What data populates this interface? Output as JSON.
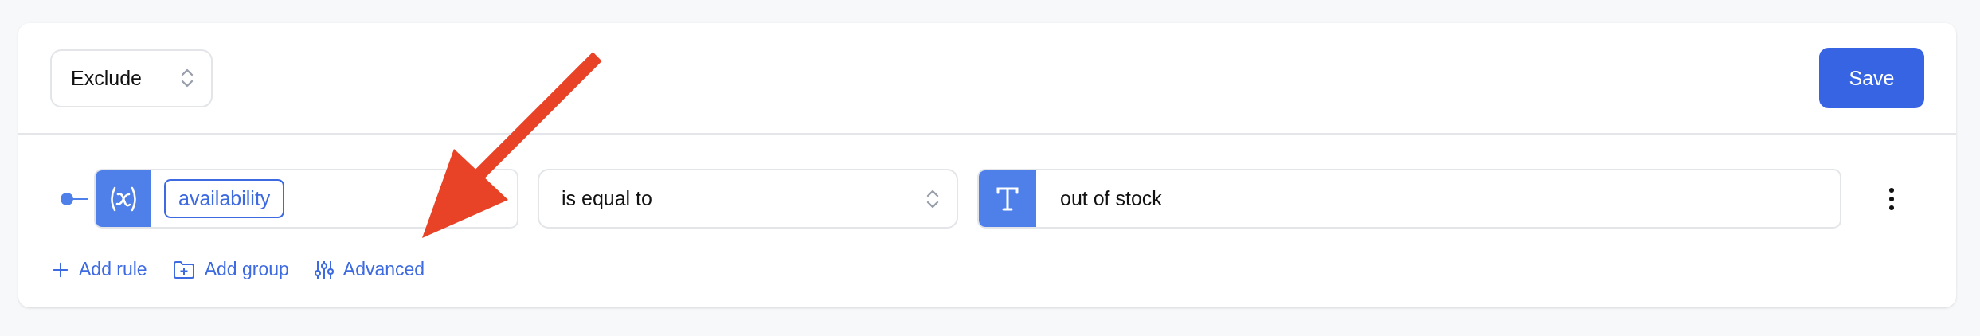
{
  "mode_select": {
    "value": "Exclude"
  },
  "save_button": {
    "label": "Save"
  },
  "rule": {
    "field": {
      "kind": "variable",
      "value": "availability"
    },
    "operator": {
      "value": "is equal to"
    },
    "value": {
      "kind": "text",
      "value": "out of stock"
    }
  },
  "actions": [
    {
      "kind": "add-rule",
      "label": "Add rule"
    },
    {
      "kind": "add-group",
      "label": "Add group"
    },
    {
      "kind": "advanced",
      "label": "Advanced"
    }
  ]
}
